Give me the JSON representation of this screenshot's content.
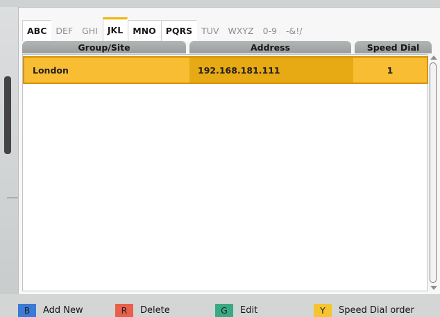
{
  "tabs": [
    {
      "label": "ABC",
      "enabled": true,
      "selected": false
    },
    {
      "label": "DEF",
      "enabled": false,
      "selected": false
    },
    {
      "label": "GHI",
      "enabled": false,
      "selected": false
    },
    {
      "label": "JKL",
      "enabled": true,
      "selected": true
    },
    {
      "label": "MNO",
      "enabled": true,
      "selected": false
    },
    {
      "label": "PQRS",
      "enabled": true,
      "selected": false
    },
    {
      "label": "TUV",
      "enabled": false,
      "selected": false
    },
    {
      "label": "WXYZ",
      "enabled": false,
      "selected": false
    },
    {
      "label": "0-9",
      "enabled": false,
      "selected": false
    },
    {
      "label": "-&!/",
      "enabled": false,
      "selected": false
    }
  ],
  "columns": {
    "group_site": "Group/Site",
    "address": "Address",
    "speed_dial": "Speed Dial"
  },
  "rows": [
    {
      "group_site": "London",
      "address": "192.168.181.111",
      "speed_dial": "1",
      "selected": true
    }
  ],
  "footer": {
    "blue": {
      "key": "B",
      "label": "Add New",
      "color": "#3a7bd5"
    },
    "red": {
      "key": "R",
      "label": "Delete",
      "color": "#e8604c"
    },
    "green": {
      "key": "G",
      "label": "Edit",
      "color": "#3aaa86"
    },
    "yellow": {
      "key": "Y",
      "label": "Speed Dial order",
      "color": "#f5c431"
    }
  },
  "colors": {
    "selection": "#f9bd34",
    "selection_border": "#d59100",
    "tab_accent": "#f2b400"
  }
}
